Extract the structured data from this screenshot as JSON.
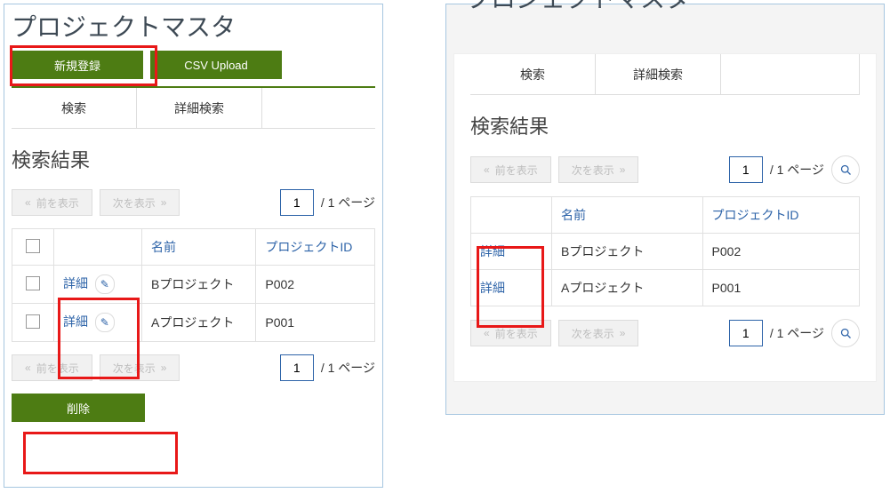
{
  "left": {
    "title": "プロジェクトマスタ",
    "btn_new": "新規登録",
    "btn_csv": "CSV Upload",
    "tabs": {
      "search": "検索",
      "detail": "詳細検索"
    },
    "section": "検索結果",
    "pager": {
      "prev": "前を表示",
      "next": "次を表示",
      "page": "1",
      "total": "/  1 ページ"
    },
    "cols": {
      "name": "名前",
      "pid": "プロジェクトID"
    },
    "rows": [
      {
        "detail": "詳細",
        "name": "Bプロジェクト",
        "pid": "P002"
      },
      {
        "detail": "詳細",
        "name": "Aプロジェクト",
        "pid": "P001"
      }
    ],
    "delete": "削除"
  },
  "right": {
    "title": "プロジェクトマスタ",
    "tabs": {
      "search": "検索",
      "detail": "詳細検索"
    },
    "section": "検索結果",
    "pager": {
      "prev": "前を表示",
      "next": "次を表示",
      "page": "1",
      "total": "/  1 ページ"
    },
    "cols": {
      "name": "名前",
      "pid": "プロジェクトID"
    },
    "rows": [
      {
        "detail": "詳細",
        "name": "Bプロジェクト",
        "pid": "P002"
      },
      {
        "detail": "詳細",
        "name": "Aプロジェクト",
        "pid": "P001"
      }
    ]
  },
  "glyph": {
    "prev": "«",
    "next": "»",
    "search": "🔍",
    "pencil": "✎"
  }
}
